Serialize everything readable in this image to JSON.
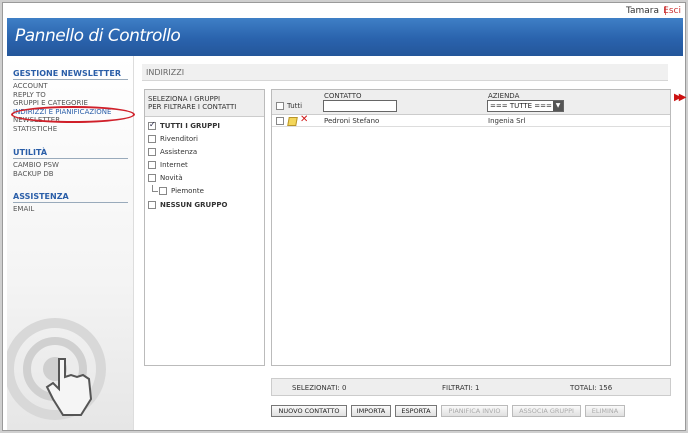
{
  "topbar": {
    "user": "Tamara",
    "separator": "|",
    "logout": "Esci"
  },
  "header": {
    "title": "Pannello di Controllo"
  },
  "sidebar": {
    "sections": [
      {
        "title": "GESTIONE NEWSLETTER",
        "items": [
          "ACCOUNT",
          "REPLY TO",
          "GRUPPI E CATEGORIE",
          "INDIRIZZI E PIANIFICAZIONE",
          "NEWSLETTER",
          "STATISTICHE"
        ]
      },
      {
        "title": "UTILITÀ",
        "items": [
          "CAMBIO PSW",
          "BACKUP DB"
        ]
      },
      {
        "title": "ASSISTENZA",
        "items": [
          "EMAIL"
        ]
      }
    ]
  },
  "main": {
    "section_title": "INDIRIZZI",
    "groups_panel": {
      "header": [
        "SELEZIONA I GRUPPI",
        "PER FILTRARE I CONTATTI"
      ],
      "items": [
        {
          "label": "TUTTI I GRUPPI",
          "checked": true,
          "bold": true
        },
        {
          "label": "Rivenditori",
          "checked": false
        },
        {
          "label": "Assistenza",
          "checked": false
        },
        {
          "label": "Internet",
          "checked": false
        },
        {
          "label": "Novità",
          "checked": false
        },
        {
          "label": "Piemonte",
          "checked": false,
          "child": true
        },
        {
          "label": "NESSUN GRUPPO",
          "checked": false,
          "bold": true
        }
      ]
    },
    "table": {
      "select_all_label": "Tutti",
      "contatto_label": "CONTATTO",
      "contatto_value": "",
      "azienda_label": "AZIENDA",
      "azienda_selected": "=== TUTTE ===",
      "rows": [
        {
          "contatto": "Pedroni Stefano",
          "azienda": "Ingenia Srl"
        }
      ]
    },
    "stats": {
      "selected": "SELEZIONATI: 0",
      "filtered": "FILTRATI: 1",
      "total": "TOTALI: 156"
    },
    "buttons": {
      "new_contact": "NUOVO CONTATTO",
      "import": "IMPORTA",
      "export": "ESPORTA",
      "schedule": "PIANIFICA INVIO",
      "assign_groups": "ASSOCIA GRUPPI",
      "delete": "ELIMINA"
    }
  },
  "colors": {
    "banner": "#2a63ad",
    "accent": "#2a5ea8",
    "highlight": "#d0202a"
  },
  "icons": [
    "pencil-edit-icon",
    "delete-x-icon",
    "double-arrow-right-icon",
    "pointing-hand-icon"
  ]
}
